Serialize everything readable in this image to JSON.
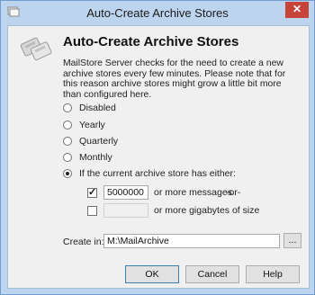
{
  "window": {
    "title": "Auto-Create Archive Stores",
    "close_glyph": "✕"
  },
  "header": {
    "icon": "archive-stores-icon",
    "title": "Auto-Create Archive Stores",
    "description": "MailStore Server checks for the need to create a new archive stores every few minutes. Please note that for this reason archive stores might grow a little bit more than configured here."
  },
  "options": [
    {
      "label": "Disabled",
      "checked": false
    },
    {
      "label": "Yearly",
      "checked": false
    },
    {
      "label": "Quarterly",
      "checked": false
    },
    {
      "label": "Monthly",
      "checked": false
    },
    {
      "label": "If the current archive store has either:",
      "checked": true
    }
  ],
  "conditions": {
    "messages": {
      "checked": true,
      "value": "5000000",
      "suffix": "or more messages",
      "or_label": "-or-"
    },
    "gigabytes": {
      "checked": false,
      "value": "",
      "suffix": "or more gigabytes of size"
    }
  },
  "create_in": {
    "label": "Create in:",
    "value": "M:\\MailArchive",
    "browse_label": "..."
  },
  "buttons": {
    "ok": "OK",
    "cancel": "Cancel",
    "help": "Help"
  },
  "colors": {
    "title_bar": "#bdd4ee",
    "close_button": "#c8443a",
    "client": "#f0f0f0"
  }
}
